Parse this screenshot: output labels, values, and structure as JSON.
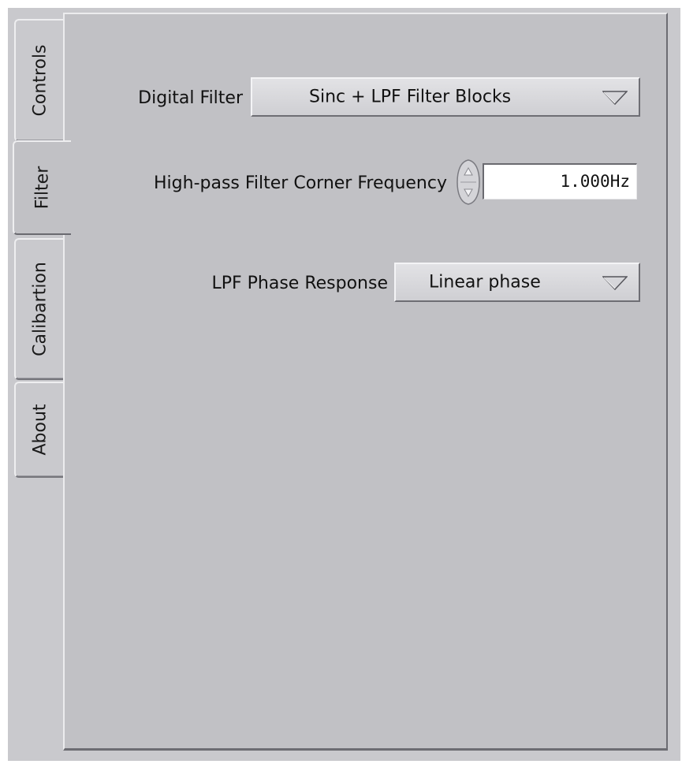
{
  "tabs": [
    {
      "label": "Controls",
      "active": false
    },
    {
      "label": "Filter",
      "active": true
    },
    {
      "label": "Calibartion",
      "active": false
    },
    {
      "label": "About",
      "active": false
    }
  ],
  "filter_panel": {
    "digital_filter": {
      "label": "Digital Filter",
      "value": "Sinc + LPF Filter Blocks",
      "icon": "dropdown-arrow-icon"
    },
    "hpf_corner": {
      "label": "High-pass Filter Corner Frequency",
      "value": "1.000Hz",
      "icon": "spinner-icon"
    },
    "lpf_phase": {
      "label": "LPF Phase Response",
      "value": "Linear phase",
      "icon": "dropdown-arrow-icon"
    }
  },
  "colors": {
    "panel_background": "#c1c1c5",
    "window_background": "#c9c9cd",
    "field_background": "#ffffff",
    "text": "#111111"
  }
}
